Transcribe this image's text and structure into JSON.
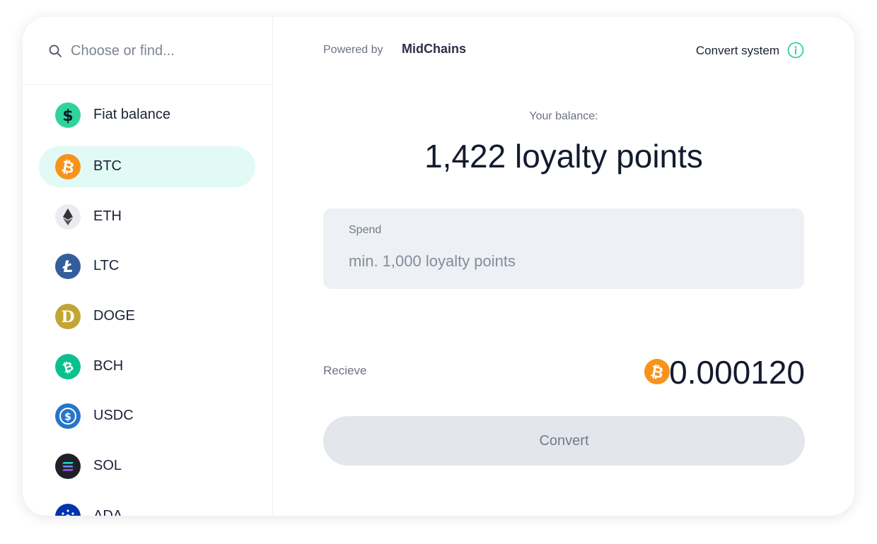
{
  "search": {
    "placeholder": "Choose or find..."
  },
  "coins": [
    {
      "label": "Fiat balance",
      "icon": "dollar-icon",
      "color": "#2fd39c",
      "active": false
    },
    {
      "label": "BTC",
      "icon": "bitcoin-icon",
      "color": "#f7931a",
      "active": true
    },
    {
      "label": "ETH",
      "icon": "ethereum-icon",
      "color": "#ececf0",
      "active": false
    },
    {
      "label": "LTC",
      "icon": "litecoin-icon",
      "color": "#345d9d",
      "active": false
    },
    {
      "label": "DOGE",
      "icon": "dogecoin-icon",
      "color": "#c2a633",
      "active": false
    },
    {
      "label": "BCH",
      "icon": "bitcoin-cash-icon",
      "color": "#0ac18e",
      "active": false
    },
    {
      "label": "USDC",
      "icon": "usdc-icon",
      "color": "#2775ca",
      "active": false
    },
    {
      "label": "SOL",
      "icon": "solana-icon",
      "color": "#1f2027",
      "active": false
    },
    {
      "label": "ADA",
      "icon": "cardano-icon",
      "color": "#0033ad",
      "active": false
    }
  ],
  "header": {
    "powered_by": "Powered by",
    "brand": "MidChains",
    "convert_system": "Convert system"
  },
  "balance": {
    "label": "Your balance:",
    "value": "1,422 loyalty points"
  },
  "spend": {
    "label": "Spend",
    "placeholder": "min. 1,000 loyalty points"
  },
  "receive": {
    "label": "Recieve",
    "value": "0.000120",
    "icon": "bitcoin-icon"
  },
  "convert_button": {
    "label": "Convert"
  },
  "colors": {
    "accent": "#2fd39c",
    "active_bg": "#e2faf6",
    "bitcoin": "#f7931a",
    "text_dark": "#141a2e",
    "text_muted": "#6b7280"
  }
}
